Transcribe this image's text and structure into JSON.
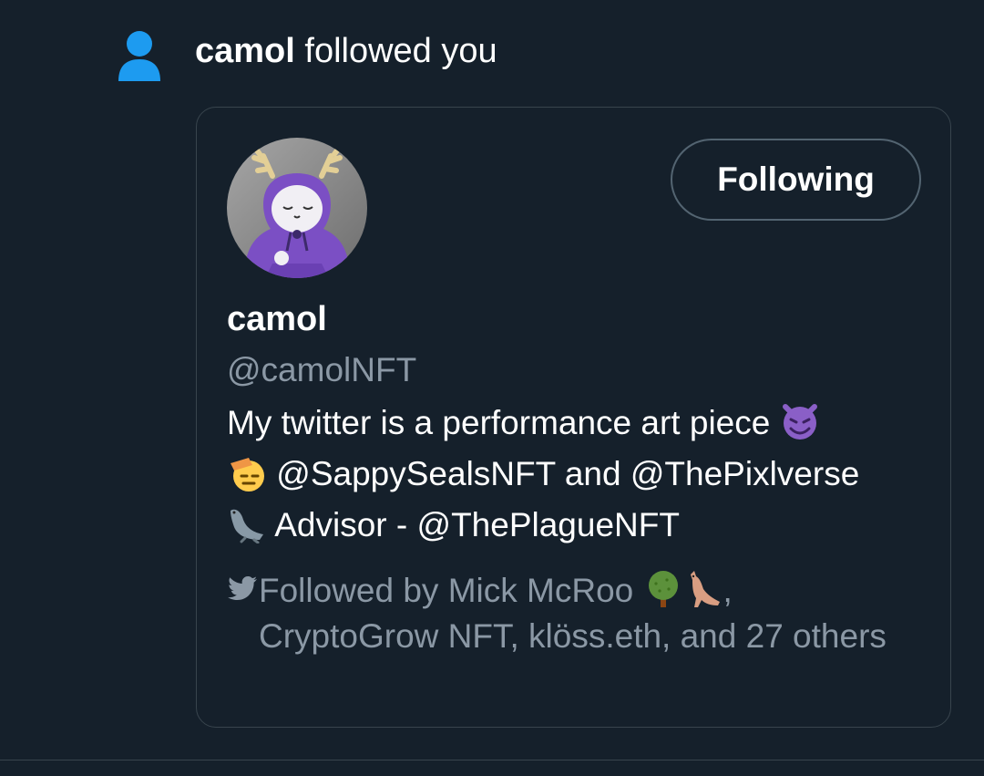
{
  "notification": {
    "actor_name": "camol",
    "action_text": " followed you",
    "icon": "person-icon"
  },
  "profile_card": {
    "display_name": "camol",
    "handle": "@camolNFT",
    "follow_button_label": "Following",
    "bio": {
      "line1_text": "My twitter is a performance art piece ",
      "line1_emoji": "smiling-imp-emoji",
      "line2_emoji": "saluting-face-emoji",
      "line2_text": " @SappySealsNFT and @ThePixlverse",
      "line3_emoji": "seal-emoji",
      "line3_text": " Advisor - @ThePlagueNFT"
    },
    "followed_by": {
      "icon": "twitter-bird-icon",
      "prefix": "Followed by Mick McRoo ",
      "emojis": [
        "tree-emoji",
        "kangaroo-emoji"
      ],
      "suffix": ", CryptoGrow NFT, klöss.eth, and 27 others"
    }
  },
  "colors": {
    "background": "#15202b",
    "border": "#38444d",
    "secondary_text": "#8b98a5",
    "accent_blue": "#1d9bf0"
  }
}
